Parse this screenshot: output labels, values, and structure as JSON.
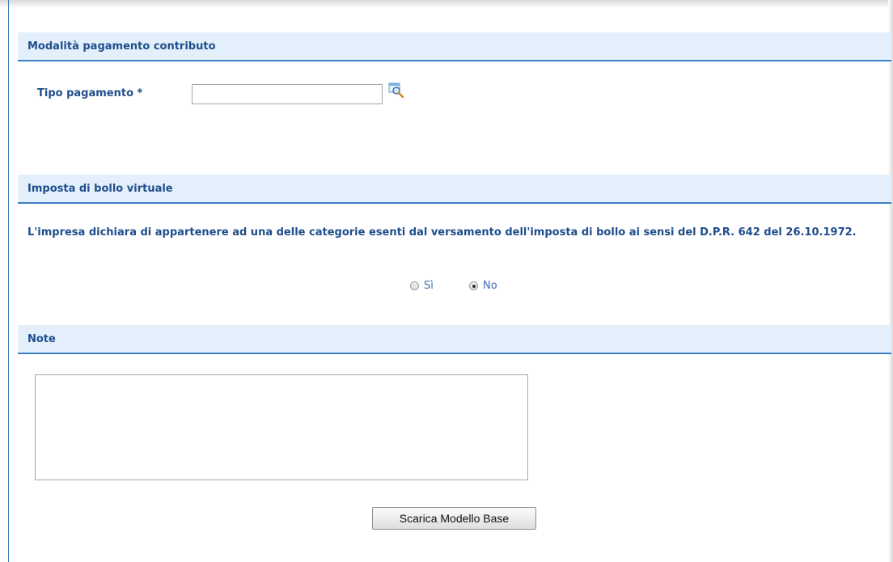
{
  "sections": {
    "payment": {
      "title": "Modalità pagamento contributo",
      "tipo_pagamento_label": "Tipo pagamento *",
      "tipo_pagamento_value": "",
      "lookup_icon": "magnifier-icon"
    },
    "stamp_duty": {
      "title": "Imposta di bollo virtuale",
      "declaration": "L'impresa dichiara di appartenere ad una delle categorie esenti dal versamento dell'imposta di bollo ai sensi del D.P.R. 642 del 26.10.1972.",
      "options": [
        {
          "label": "Sì",
          "checked": false
        },
        {
          "label": "No",
          "checked": true
        }
      ]
    },
    "notes": {
      "title": "Note",
      "value": ""
    }
  },
  "actions": {
    "download_label": "Scarica Modello Base"
  },
  "colors": {
    "header_bg": "#e3f0fc",
    "accent": "#3c7fc4",
    "label_text": "#1f4e8c"
  }
}
